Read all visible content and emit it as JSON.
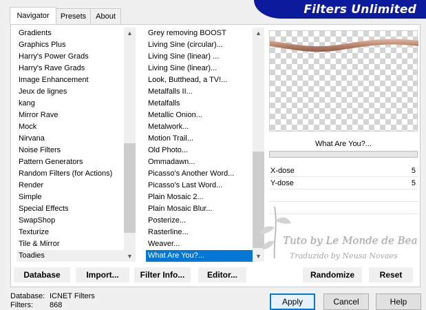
{
  "tabs": [
    "Navigator",
    "Presets",
    "About"
  ],
  "banner_title": "Filters Unlimited",
  "categories": [
    "Gradients",
    "Graphics Plus",
    "Harry's Power Grads",
    "Harry's Rave Grads",
    "Image Enhancement",
    "Jeux de lignes",
    "kang",
    "Mirror Rave",
    "Mock",
    "Nirvana",
    "Noise Filters",
    "Pattern Generators",
    "Random Filters (for Actions)",
    "Render",
    "Simple",
    "Special Effects",
    "SwapShop",
    "Texturize",
    "Tile & Mirror",
    "Toadies"
  ],
  "filters": [
    "Grey removing BOOST",
    "Living Sine (circular)...",
    "Living Sine (linear) ...",
    "Living Sine (linear)...",
    "Look, Butthead, a TV!...",
    "Metalfalls II...",
    "Metalfalls",
    "Metallic Onion...",
    "Metalwork...",
    "Motion Trail...",
    "Old Photo...",
    "Ommadawn...",
    "Picasso's Another Word...",
    "Picasso's Last Word...",
    "Plain Mosaic 2...",
    "Plain Mosaic Blur...",
    "Posterize...",
    "Rasterline...",
    "Weaver...",
    "What Are You?..."
  ],
  "selected_filter": "What Are You?...",
  "filter_title": "What Are You?...",
  "params": [
    {
      "label": "X-dose",
      "value": "5"
    },
    {
      "label": "Y-dose",
      "value": "5"
    }
  ],
  "watermark": {
    "line1": "Tuto by Le Monde de Bea",
    "line2": "Traduzido by Neusa Novaes"
  },
  "bottom_buttons": {
    "database": "Database",
    "import": "Import...",
    "filter_info": "Filter Info...",
    "editor": "Editor...",
    "randomize": "Randomize",
    "reset": "Reset"
  },
  "status": {
    "database_label": "Database:",
    "database_value": "ICNET Filters",
    "filters_label": "Filters:",
    "filters_value": "868"
  },
  "dialog_buttons": {
    "apply": "Apply",
    "cancel": "Cancel",
    "help": "Help"
  },
  "colors": {
    "banner_bg": "#0c1a9c",
    "selection": "#0078d7",
    "wave": "#c8957f"
  }
}
